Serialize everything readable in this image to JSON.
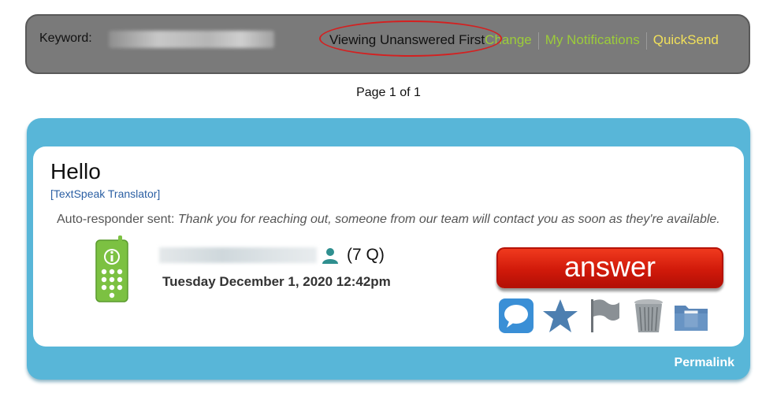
{
  "topbar": {
    "keyword_label": "Keyword:",
    "view_mode": "Viewing Unanswered First",
    "change_link": "Change",
    "notifications_link": "My Notifications",
    "quicksend_link": "QuickSend"
  },
  "pagination": {
    "text": "Page 1 of 1"
  },
  "message": {
    "title": "Hello",
    "translator_link": "[TextSpeak Translator]",
    "auto_responder_label": "Auto-responder sent:",
    "auto_responder_text": "Thank you for reaching out, someone from our team will contact you as soon as they're available.",
    "question_count": "(7 Q)",
    "timestamp": "Tuesday December 1, 2020 12:42pm",
    "answer_label": "answer",
    "permalink": "Permalink"
  },
  "icons": [
    "phone-info-icon",
    "user-icon",
    "chat-bubble-icon",
    "star-icon",
    "flag-icon",
    "trash-icon",
    "folder-icon"
  ],
  "colors": {
    "topbar_bg": "#7a7a7a",
    "link_green": "#9ccc3a",
    "link_yellow": "#f1e05a",
    "card_blue": "#58b6d8",
    "answer_red": "#d11a0a",
    "highlight_circle": "#d42020"
  }
}
